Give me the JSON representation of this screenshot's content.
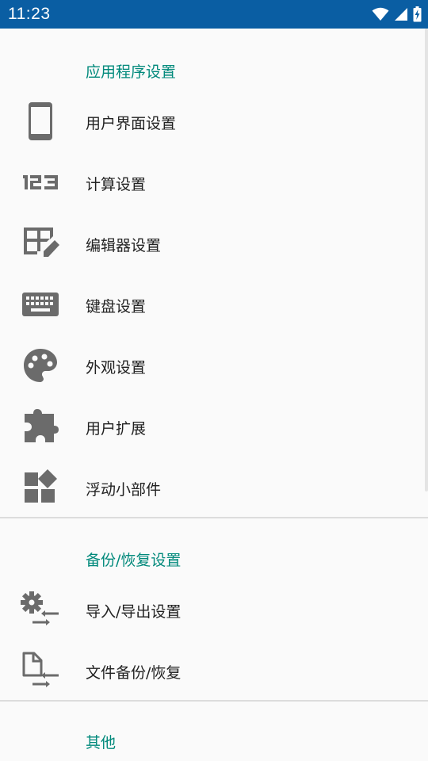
{
  "status_bar": {
    "time": "11:23",
    "icons": [
      "wifi-icon",
      "cell-signal-icon",
      "battery-charging-icon"
    ]
  },
  "sections": [
    {
      "header": "应用程序设置",
      "items": [
        {
          "label": "用户界面设置",
          "icon": "phone-icon"
        },
        {
          "label": "计算设置",
          "icon": "numeric-123-icon"
        },
        {
          "label": "编辑器设置",
          "icon": "table-edit-icon"
        },
        {
          "label": "键盘设置",
          "icon": "keyboard-icon"
        },
        {
          "label": "外观设置",
          "icon": "palette-icon"
        },
        {
          "label": "用户扩展",
          "icon": "puzzle-icon"
        },
        {
          "label": "浮动小部件",
          "icon": "widgets-icon"
        }
      ]
    },
    {
      "header": "备份/恢复设置",
      "items": [
        {
          "label": "导入/导出设置",
          "icon": "settings-transfer-icon"
        },
        {
          "label": "文件备份/恢复",
          "icon": "file-transfer-icon"
        }
      ]
    },
    {
      "header": "其他",
      "items": []
    }
  ],
  "colors": {
    "status_bar": "#0a5ea3",
    "section_header": "#00897b",
    "icon": "#6b6b6b",
    "text": "#222222",
    "background": "#fafafa"
  }
}
